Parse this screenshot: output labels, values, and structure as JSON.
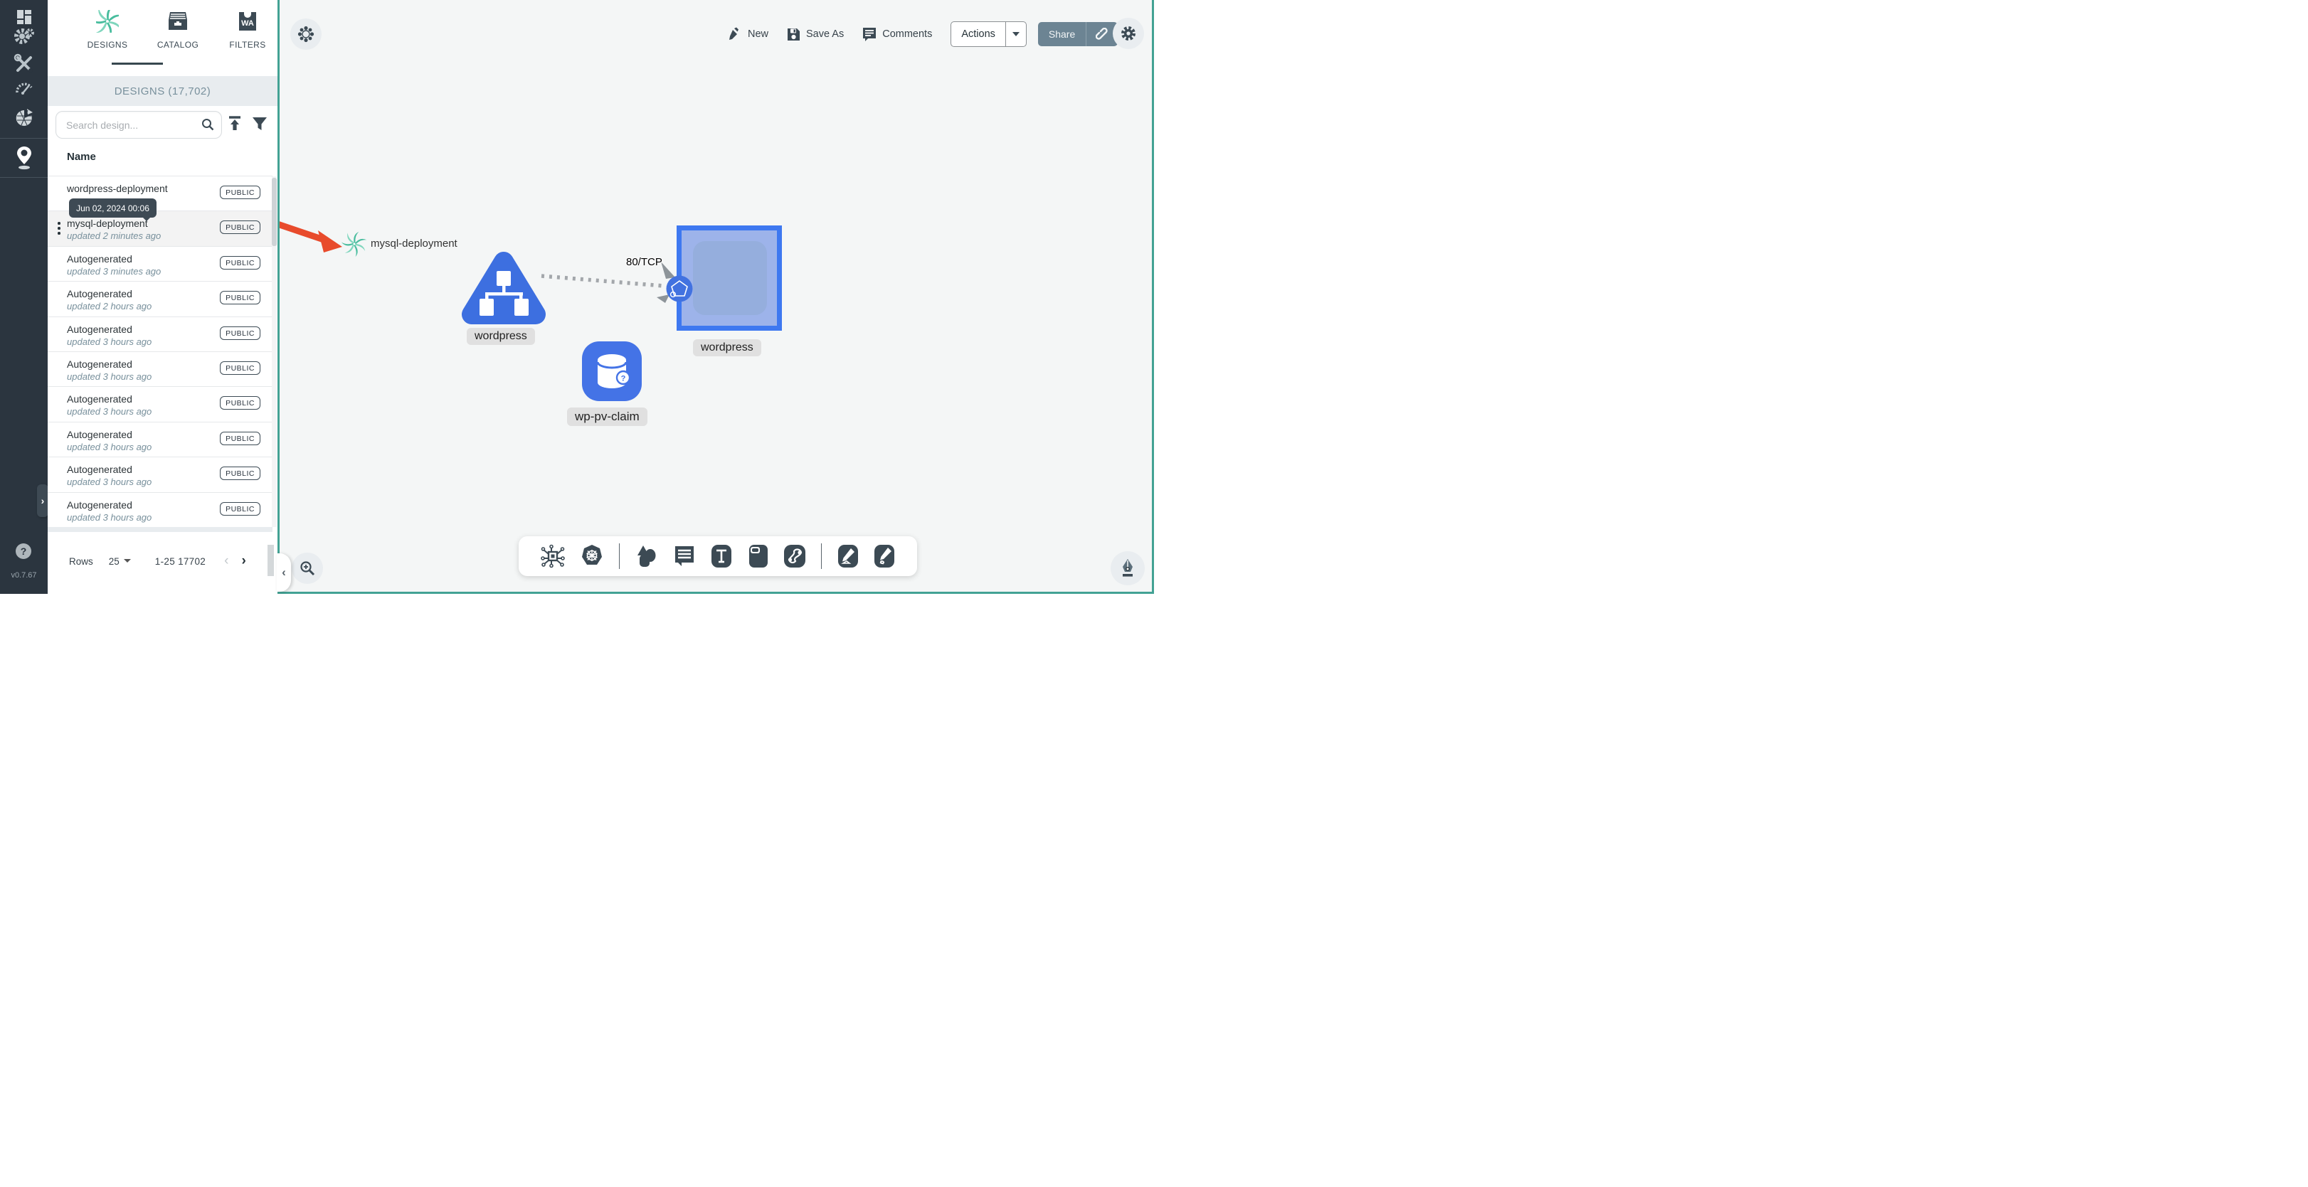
{
  "app": {
    "version": "v0.7.67"
  },
  "sidebar": {
    "items": [
      {
        "icon": "dashboard-icon"
      },
      {
        "icon": "lifecycle-gears-icon"
      },
      {
        "icon": "configuration-tools-icon"
      },
      {
        "icon": "performance-gauge-icon"
      },
      {
        "icon": "extensions-mesh-icon"
      },
      {
        "icon": "kanvas-pin-icon",
        "active": true
      }
    ],
    "expand_chevron": "›",
    "help_label": "?"
  },
  "panel": {
    "tabs": [
      {
        "label": "DESIGNS",
        "icon": "meshery-spiral-icon",
        "active": true
      },
      {
        "label": "CATALOG",
        "icon": "catalog-drawer-icon"
      },
      {
        "label": "FILTERS",
        "icon": "filters-wasm-icon",
        "icon_text": "WA"
      }
    ],
    "header": "DESIGNS (17,702)",
    "search": {
      "placeholder": "Search design..."
    },
    "table": {
      "name_header": "Name",
      "rows": [
        {
          "name": "wordpress-deployment",
          "updated": "",
          "badge": "PUBLIC",
          "hovered": false
        },
        {
          "name": "mysql-deployment",
          "updated": "updated 2 minutes ago",
          "badge": "PUBLIC",
          "hovered": true
        },
        {
          "name": "Autogenerated",
          "updated": "updated 3 minutes ago",
          "badge": "PUBLIC",
          "hovered": false
        },
        {
          "name": "Autogenerated",
          "updated": "updated 2 hours ago",
          "badge": "PUBLIC",
          "hovered": false
        },
        {
          "name": "Autogenerated",
          "updated": "updated 3 hours ago",
          "badge": "PUBLIC",
          "hovered": false
        },
        {
          "name": "Autogenerated",
          "updated": "updated 3 hours ago",
          "badge": "PUBLIC",
          "hovered": false
        },
        {
          "name": "Autogenerated",
          "updated": "updated 3 hours ago",
          "badge": "PUBLIC",
          "hovered": false
        },
        {
          "name": "Autogenerated",
          "updated": "updated 3 hours ago",
          "badge": "PUBLIC",
          "hovered": false
        },
        {
          "name": "Autogenerated",
          "updated": "updated 3 hours ago",
          "badge": "PUBLIC",
          "hovered": false
        },
        {
          "name": "Autogenerated",
          "updated": "updated 3 hours ago",
          "badge": "PUBLIC",
          "hovered": false
        }
      ]
    },
    "tooltip": {
      "text": "Jun 02, 2024 00:06"
    },
    "pagination": {
      "rows_label": "Rows",
      "per_page": "25",
      "range": "1-25 17702",
      "prev": "‹",
      "next": "›"
    }
  },
  "toolbar": {
    "new_label": "New",
    "save_as_label": "Save As",
    "comments_label": "Comments",
    "actions_label": "Actions",
    "share_label": "Share"
  },
  "canvas": {
    "edge": {
      "label": "80/TCP"
    },
    "nodes": [
      {
        "id": "mysql-design",
        "label": "mysql-deployment",
        "type": "meshery-design"
      },
      {
        "id": "wordpress-service",
        "label": "wordpress",
        "type": "service-triangle"
      },
      {
        "id": "wordpress-deployment",
        "label": "wordpress",
        "type": "deployment-square",
        "selected": true
      },
      {
        "id": "wp-pv-claim",
        "label": "wp-pv-claim",
        "type": "persistent-volume-claim"
      }
    ],
    "colors": {
      "node_blue": "#3d6fe0",
      "square_border": "#3e78f0",
      "square_fill": "#9db3ea",
      "square_inner": "#95aedd",
      "brand_teal": "#43a294",
      "spiral_teal": "#52c3a5",
      "arrow_red": "#e84b2c",
      "slate": "#3c4a54"
    }
  }
}
